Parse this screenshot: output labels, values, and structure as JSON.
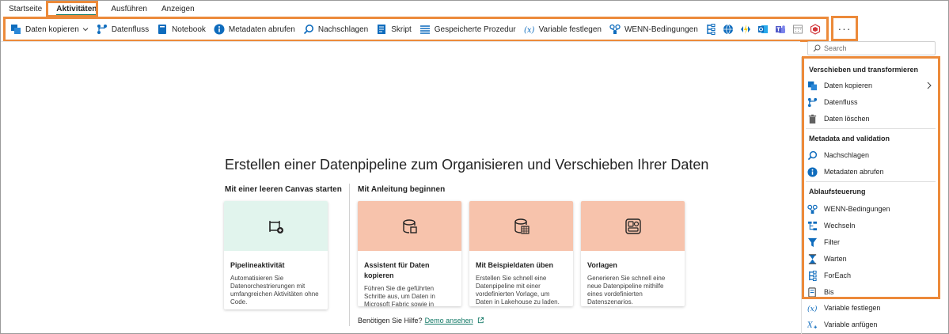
{
  "tabs": [
    {
      "label": "Startseite",
      "active": false
    },
    {
      "label": "Aktivitäten",
      "active": true
    },
    {
      "label": "Ausführen",
      "active": false
    },
    {
      "label": "Anzeigen",
      "active": false
    }
  ],
  "toolbar": {
    "items": [
      {
        "label": "Daten kopieren",
        "icon": "copy-data-icon",
        "has_dropdown": true
      },
      {
        "label": "Datenfluss",
        "icon": "dataflow-icon"
      },
      {
        "label": "Notebook",
        "icon": "notebook-icon"
      },
      {
        "label": "Metadaten abrufen",
        "icon": "info-icon"
      },
      {
        "label": "Nachschlagen",
        "icon": "lookup-icon"
      },
      {
        "label": "Skript",
        "icon": "script-icon"
      },
      {
        "label": "Gespeicherte Prozedur",
        "icon": "stored-procedure-icon"
      },
      {
        "label": "Variable festlegen",
        "icon": "variable-icon"
      },
      {
        "label": "WENN-Bedingungen",
        "icon": "if-condition-icon"
      }
    ],
    "icon_only": [
      "foreach-icon",
      "web-icon",
      "azure-function-icon",
      "outlook-icon",
      "teams-icon",
      "calendar-icon",
      "kql-icon"
    ],
    "more_label": "···"
  },
  "main": {
    "heading": "Erstellen einer Datenpipeline zum Organisieren und Verschieben Ihrer Daten",
    "left_section_label": "Mit einer leeren Canvas starten",
    "right_section_label": "Mit Anleitung beginnen",
    "cards": [
      {
        "title": "Pipelineaktivität",
        "description": "Automatisieren Sie Datenorchestrierungen mit umfangreichen Aktivitäten ohne Code.",
        "banner_color": "#e1f4ed",
        "icon": "pipeline-activity-icon"
      },
      {
        "title": "Assistent für Daten kopieren",
        "description": "Führen Sie die geführten Schritte aus, um Daten in Microsoft Fabric sowie in andere Datenspeicher zu kopieren.",
        "banner_color": "#f7c3ac",
        "icon": "copy-assistant-icon"
      },
      {
        "title": "Mit Beispieldaten üben",
        "description": "Erstellen Sie schnell eine Datenpipeline mit einer vordefinierten Vorlage, um Daten in Lakehouse zu laden.",
        "banner_color": "#f7c3ac",
        "icon": "sample-data-icon"
      },
      {
        "title": "Vorlagen",
        "description": "Generieren Sie schnell eine neue Datenpipeline mithilfe eines vordefinierten Datenszenarios.",
        "banner_color": "#f7c3ac",
        "icon": "templates-icon"
      }
    ],
    "help_text": "Benötigen Sie Hilfe?",
    "help_link": "Demo ansehen"
  },
  "panel": {
    "search_placeholder": "Search",
    "groups": [
      {
        "title": "Verschieben und transformieren",
        "items": [
          {
            "label": "Daten kopieren",
            "icon": "copy-data-icon",
            "has_submenu": true
          },
          {
            "label": "Datenfluss",
            "icon": "dataflow-icon"
          },
          {
            "label": "Daten löschen",
            "icon": "trash-icon"
          }
        ]
      },
      {
        "title": "Metadata and validation",
        "items": [
          {
            "label": "Nachschlagen",
            "icon": "lookup-icon"
          },
          {
            "label": "Metadaten abrufen",
            "icon": "info-icon"
          }
        ]
      },
      {
        "title": "Ablaufsteuerung",
        "items": [
          {
            "label": "WENN-Bedingungen",
            "icon": "if-condition-icon"
          },
          {
            "label": "Wechseln",
            "icon": "switch-icon"
          },
          {
            "label": "Filter",
            "icon": "filter-icon"
          },
          {
            "label": "Warten",
            "icon": "hourglass-icon"
          },
          {
            "label": "ForEach",
            "icon": "foreach-icon"
          },
          {
            "label": "Bis",
            "icon": "until-icon"
          },
          {
            "label": "Variable festlegen",
            "icon": "variable-icon"
          },
          {
            "label": "Variable anfügen",
            "icon": "append-variable-icon"
          }
        ]
      }
    ]
  },
  "colors": {
    "highlight": "#ec8a3a",
    "accent_teal": "#117865",
    "brand_blue": "#0f6cbd"
  }
}
